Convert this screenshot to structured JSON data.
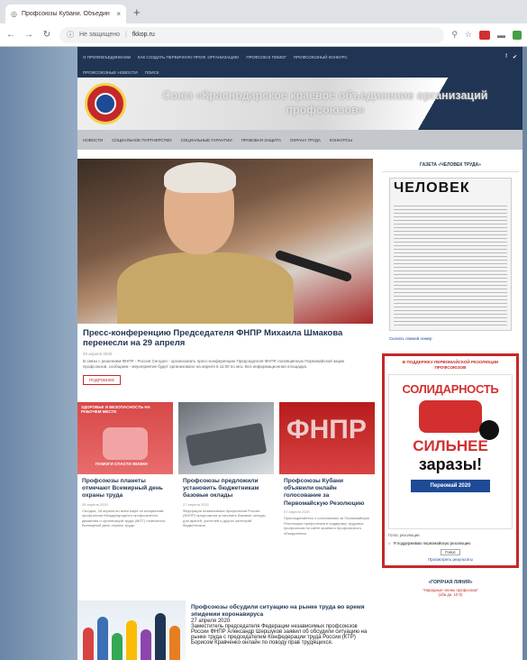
{
  "browser": {
    "tab_title": "Профсоюзы Кубани. Объедин",
    "tab_close": "×",
    "new_tab": "+",
    "security_label": "Не защищено",
    "url": "fkkop.ru",
    "icons": [
      "globe-icon",
      "back-arrow-icon",
      "forward-arrow-icon",
      "reload-icon",
      "info-icon",
      "zoom-icon",
      "star-icon"
    ]
  },
  "site": {
    "topmenu": [
      "О ПРОФОБЪЕДИНЕНИИ",
      "КАК СОЗДАТЬ ПЕРВИЧНУЮ ПРОФ. ОРГАНИЗАЦИЮ",
      "ПРОФСОЮЗ ПОМОГ",
      "ПРОФСОЮЗНЫЙ КОНКУРС",
      "ПРОФСОЮЗНЫЕ НОВОСТИ",
      "ПОИСК"
    ],
    "title": "Союз «Краснодарское краевое объединение организаций профсоюзов»",
    "mainnav": [
      "НОВОСТИ",
      "СОЦИАЛЬНОЕ ПАРТНЕРСТВО",
      "СОЦИАЛЬНЫЕ ГАРАНТИИ",
      "ПРАВОВАЯ ЗАЩИТА",
      "ОХРАНА ТРУДА",
      "КОНКУРСЫ"
    ]
  },
  "feature": {
    "title": "Пресс-конференцию Председателя ФНПР Михаила Шмакова перенесли на 29 апреля",
    "meta": "20 апреля 2020",
    "excerpt": "В связи с решением ФНПР - Россия Сегодня - организовать пресс-конференцию Председателя ФНПР, посвящённую Первомайской акции профсоюзов, сообщаем - мероприятие будет организовано на апреля в 11:00 по мск. Вся информационная площадка.",
    "more": "ПОДРОБНЕЕ"
  },
  "cards": [
    {
      "title": "Профсоюзы планеты отмечают Всемирный день охраны труда",
      "meta": "28 апреля 2020",
      "excerpt": "Сегодня, 28 апреля во всём мире по инициативе профсоюзов Международного профсоюзного движения и организаций труда (МОТ) отмечается Всемирный день охраны труда."
    },
    {
      "title": "Профсоюзы предложили установить бюджетникам базовые оклады",
      "meta": "27 апреля 2020",
      "excerpt": "Федерация независимых профсоюзов России (ФНПР) предложила установить базовые оклады для врачей, учителей и других категорий бюджетников."
    },
    {
      "title": "Профсоюзы Кубани объявили онлайн голосование за Первомайскую Резолюцию",
      "meta": "27 апреля 2020",
      "excerpt": "Присоединяйтесь к голосованию за Первомайскую Резолюцию профсоюзов в поддержку трудовых профсоюзов на сайте краевого профсоюзного объединения."
    }
  ],
  "wide": {
    "title": "Профсоюзы обсудили ситуацию на рынке труда во время эпидемии коронавируса",
    "meta": "27 апреля 2020",
    "excerpt": "Заместитель председателя Федерации независимых профсоюзов России ФНПР Александр Шершуков заявил об обсудили ситуацию на рынке труда с председателем Конфедерации труда России (КТР) Борисом Кравченко онлайн по поводу прав трудящихся."
  },
  "card_thumb_texts": {
    "card1_banner": "ЗДОРОВЬЕ И БЕЗОПАСНОСТЬ НА РАБОЧЕМ МЕСТЕ",
    "card1_caption": "ПОМОГИ СПАСТИ ЖИЗНИ",
    "card3_logo": "ФНПР"
  },
  "sidebar": {
    "newspaper_widget_title": "ГАЗЕТА «ЧЕЛОВЕК ТРУДА»",
    "newspaper_name": "ЧЕЛОВЕК",
    "newspaper_link": "Скачать свежий номер",
    "poll_title": "В ПОДДЕРЖКУ ПЕРВОМАЙСКОЙ РЕЗОЛЮЦИИ ПРОФСОЮЗОВ",
    "poster_solidarity": "СОЛИДАРНОСТЬ",
    "poster_stronger": "СИЛЬНЕЕ",
    "poster_virus": "заразы!",
    "poster_may": "Первомай 2020",
    "poll_line": "Голос резолюции",
    "poll_option": "Я поддерживаю первомайскую резолюцию",
    "vote_btn": "Голос",
    "results_link": "Просмотреть результаты",
    "hotline_title": "«ГОРЯЧАЯ ЛИНИЯ»",
    "hotline_line1": "\"Народные члены профсоюза\"",
    "hotline_line2": "(оба дн. 10 б)"
  },
  "colors": {
    "brand_navy": "#1f3553",
    "brand_red": "#c62828",
    "poll_border": "#c62828"
  }
}
